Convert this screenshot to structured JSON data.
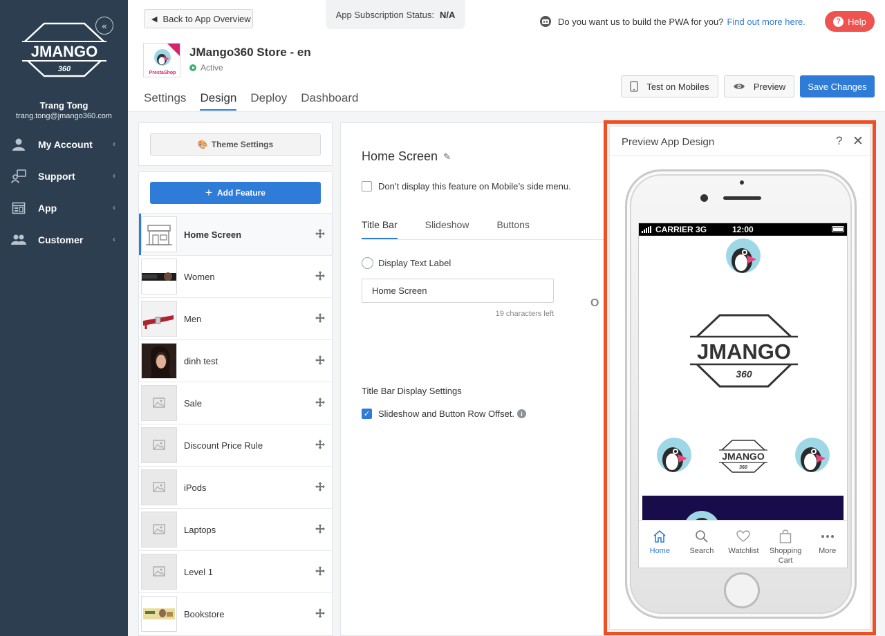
{
  "sidebar": {
    "logo_text": "JMANGO",
    "logo_sub": "360",
    "user_name": "Trang Tong",
    "user_email": "trang.tong@jmango360.com",
    "items": [
      {
        "label": "My Account",
        "icon": "user-icon"
      },
      {
        "label": "Support",
        "icon": "support-icon"
      },
      {
        "label": "App",
        "icon": "app-icon"
      },
      {
        "label": "Customer",
        "icon": "customers-icon"
      }
    ]
  },
  "header": {
    "back_label": "Back to App Overview",
    "subscription_label": "App Subscription Status:",
    "subscription_value": "N/A",
    "pwa_text": "Do you want us to build the PWA for you?",
    "pwa_link": "Find out more here.",
    "help_label": "Help",
    "store_name": "JMango360 Store - en",
    "store_status": "Active",
    "thumb_label": "PrestaShop",
    "tabs": [
      {
        "label": "Settings",
        "active": false
      },
      {
        "label": "Design",
        "active": true
      },
      {
        "label": "Deploy",
        "active": false
      },
      {
        "label": "Dashboard",
        "active": false
      }
    ],
    "test_label": "Test on Mobiles",
    "preview_label": "Preview",
    "save_label": "Save Changes"
  },
  "features": {
    "theme_label": "Theme Settings",
    "add_label": "Add Feature",
    "items": [
      {
        "label": "Home Screen",
        "thumb": "store"
      },
      {
        "label": "Women",
        "thumb": "women"
      },
      {
        "label": "Men",
        "thumb": "men"
      },
      {
        "label": "dinh test",
        "thumb": "portrait"
      },
      {
        "label": "Sale",
        "thumb": "placeholder"
      },
      {
        "label": "Discount Price Rule",
        "thumb": "placeholder"
      },
      {
        "label": "iPods",
        "thumb": "placeholder"
      },
      {
        "label": "Laptops",
        "thumb": "placeholder"
      },
      {
        "label": "Level 1",
        "thumb": "placeholder"
      },
      {
        "label": "Bookstore",
        "thumb": "bookstore"
      }
    ]
  },
  "settings": {
    "title": "Home Screen",
    "hide_side_menu_label": "Don’t display this feature on Mobile’s side menu.",
    "sub_tabs": [
      {
        "label": "Title Bar",
        "active": true
      },
      {
        "label": "Slideshow",
        "active": false
      },
      {
        "label": "Buttons",
        "active": false
      }
    ],
    "display_text_label": "Display Text Label",
    "text_value": "Home Screen",
    "chars_left": "19 characters left",
    "display_settings_title": "Title Bar Display Settings",
    "offset_label": "Slideshow and Button Row Offset.",
    "peek_char": "O"
  },
  "preview": {
    "title": "Preview App Design",
    "help_glyph": "?",
    "close_glyph": "✕",
    "carrier": "CARRIER",
    "network": "3G",
    "time": "12:00",
    "logo_text": "JMANGO",
    "logo_sub": "360",
    "nav": [
      {
        "label": "Home",
        "icon": "home-icon",
        "active": true
      },
      {
        "label": "Search",
        "icon": "search-icon",
        "active": false
      },
      {
        "label": "Watchlist",
        "icon": "heart-icon",
        "active": false
      },
      {
        "label": "Shopping Cart",
        "icon": "bag-icon",
        "active": false
      },
      {
        "label": "More",
        "icon": "more-icon",
        "active": false
      }
    ]
  },
  "colors": {
    "sidebar_bg": "#2c3e50",
    "accent": "#2f7bd8",
    "help": "#ef5350",
    "highlight_frame": "#ef4f23",
    "status_active": "#3cb371"
  }
}
